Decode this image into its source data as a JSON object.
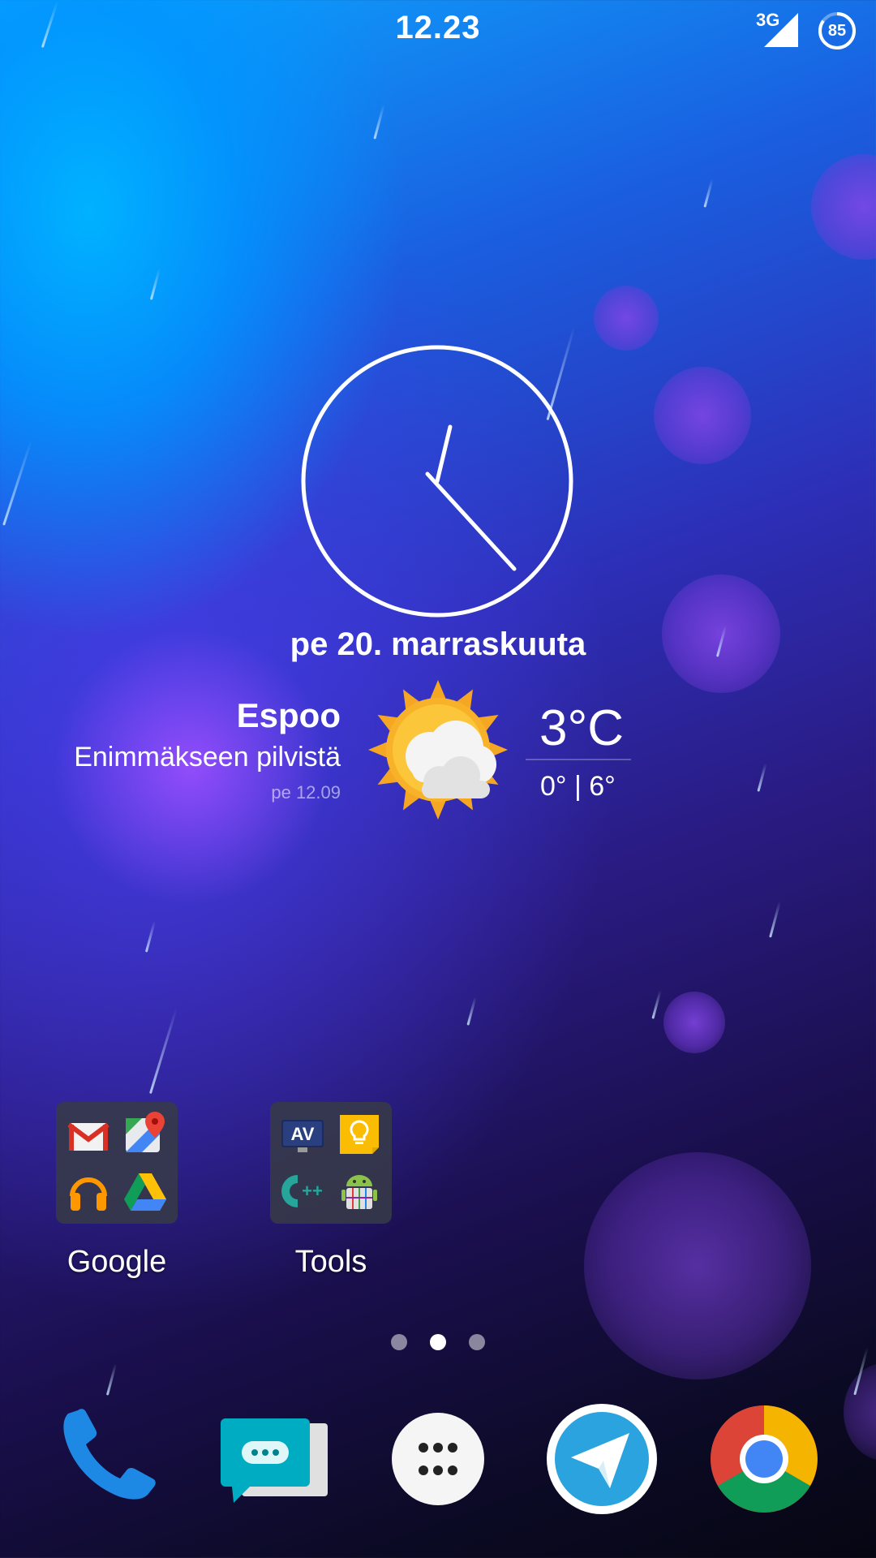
{
  "status_bar": {
    "time": "12.23",
    "network": "3G",
    "battery": "85"
  },
  "clock_widget": {
    "date": "pe 20. marraskuuta"
  },
  "weather_widget": {
    "city": "Espoo",
    "condition": "Enimmäkseen pilvistä",
    "updated": "pe 12.09",
    "temperature": "3°C",
    "range": "0° | 6°",
    "icon": "partly-cloudy-icon"
  },
  "folders": [
    {
      "label": "Google",
      "apps": [
        "gmail-icon",
        "google-maps-icon",
        "play-music-icon",
        "google-drive-icon"
      ]
    },
    {
      "label": "Tools",
      "apps": [
        "av-icon",
        "keep-icon",
        "cpp-compiler-icon",
        "android-tool-icon"
      ]
    }
  ],
  "page_indicator": {
    "pages": 3,
    "current": 2
  },
  "dock": [
    "phone-icon",
    "messages-icon",
    "app-drawer-icon",
    "telegram-icon",
    "chrome-icon"
  ],
  "colors": {
    "wallpaper_top": "#0ca6ff",
    "wallpaper_bottom": "#060612",
    "folder_bg": "#373a48"
  }
}
